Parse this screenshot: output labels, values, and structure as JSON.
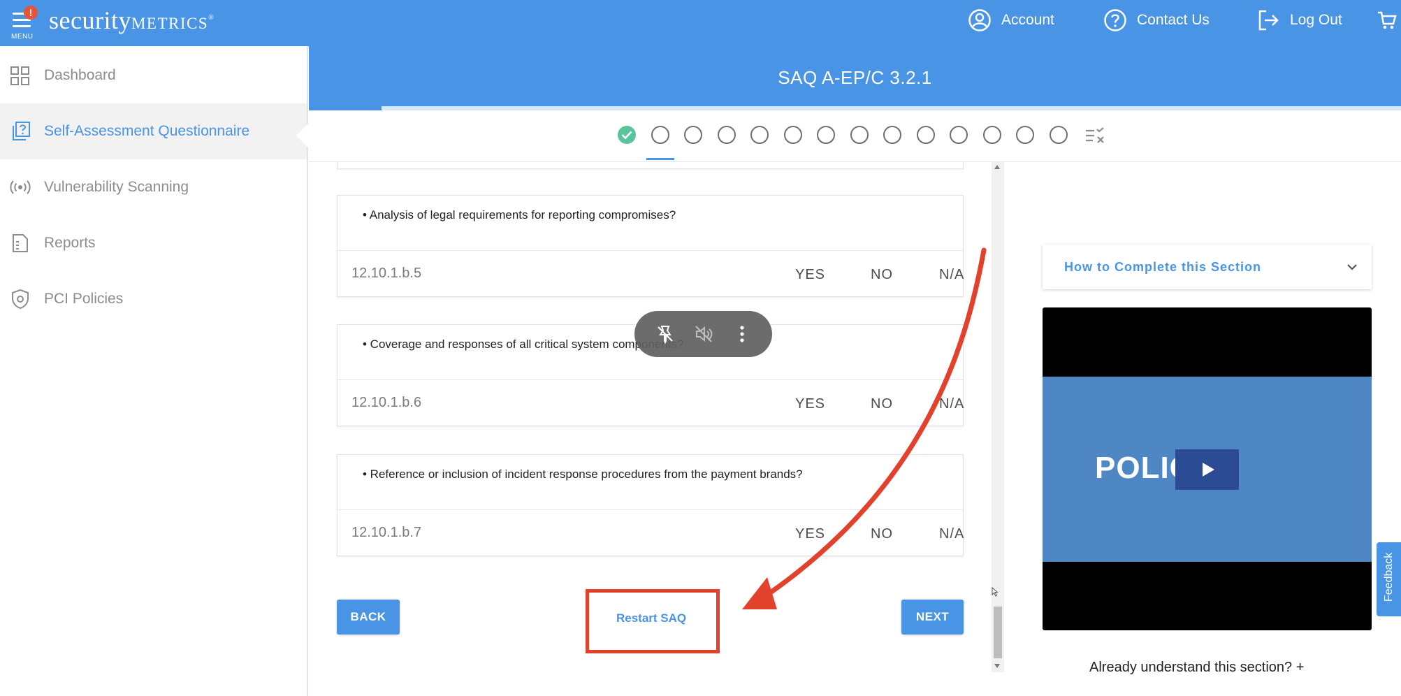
{
  "topbar": {
    "menu_badge": "!",
    "menu_label": "MENU",
    "logo_main": "security",
    "logo_caps": "METRICS",
    "logo_mark": "®",
    "account": "Account",
    "contact": "Contact Us",
    "logout": "Log Out"
  },
  "sidebar": {
    "items": [
      {
        "label": "Dashboard"
      },
      {
        "label": "Self-Assessment Questionnaire"
      },
      {
        "label": "Vulnerability Scanning"
      },
      {
        "label": "Reports"
      },
      {
        "label": "PCI Policies"
      }
    ],
    "active_index": 1
  },
  "header": {
    "title": "SAQ A-EP/C 3.2.1"
  },
  "stepper": {
    "total_steps": 14,
    "completed_steps": 1,
    "current_step": 2
  },
  "questions": [
    {
      "text": "• Analysis of legal requirements for reporting compromises?",
      "ref": "12.10.1.b.5",
      "yes": "YES",
      "no": "NO",
      "na": "N/A"
    },
    {
      "text": "• Coverage and responses of all critical system components?",
      "ref": "12.10.1.b.6",
      "yes": "YES",
      "no": "NO",
      "na": "N/A"
    },
    {
      "text": "• Reference or inclusion of incident response procedures from the payment brands?",
      "ref": "12.10.1.b.7",
      "yes": "YES",
      "no": "NO",
      "na": "N/A"
    }
  ],
  "actions": {
    "back": "BACK",
    "restart": "Restart SAQ",
    "next": "NEXT"
  },
  "right_panel": {
    "howto_title": "How to Complete this Section",
    "video_text": "POLIC",
    "already": "Already understand this section? +",
    "feedback": "Feedback"
  },
  "colors": {
    "brand_blue": "#4a94e6",
    "success_green": "#5ac59b",
    "annotation_red": "#e2422b"
  }
}
